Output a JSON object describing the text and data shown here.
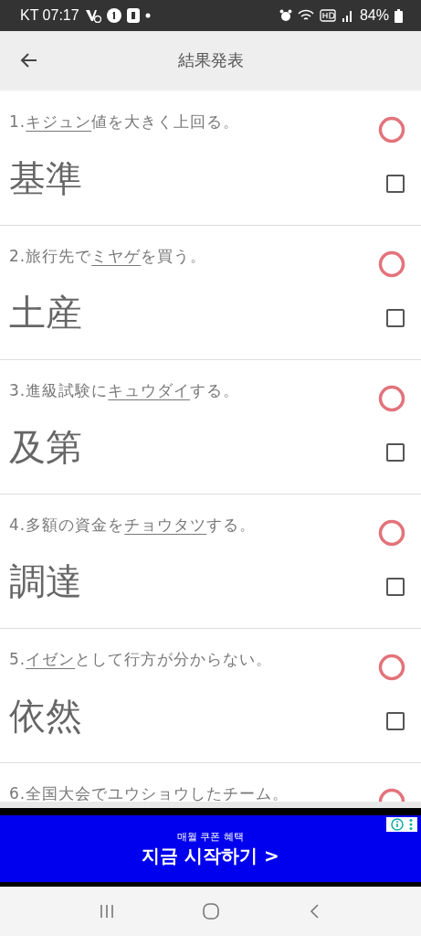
{
  "status_bar": {
    "carrier_time": "KT 07:17",
    "battery": "84%"
  },
  "app_bar": {
    "title": "結果発表"
  },
  "questions": [
    {
      "before": "1.",
      "reading": "キジュン",
      "after": "値を大きく上回る。",
      "correct": true,
      "answer": "基準",
      "checked": false
    },
    {
      "before": "2.旅行先で",
      "reading": "ミヤゲ",
      "after": "を買う。",
      "correct": true,
      "answer": "土産",
      "checked": false
    },
    {
      "before": "3.進級試験に",
      "reading": "キュウダイ",
      "after": "する。",
      "correct": true,
      "answer": "及第",
      "checked": false
    },
    {
      "before": "4.多額の資金を",
      "reading": "チョウタツ",
      "after": "する。",
      "correct": true,
      "answer": "調達",
      "checked": false
    },
    {
      "before": "5.",
      "reading": "イゼン",
      "after": "として行方が分からない。",
      "correct": true,
      "answer": "依然",
      "checked": false
    },
    {
      "before": "6.全国大会で",
      "reading": "ユウショウ",
      "after": "したチーム。",
      "correct": true
    }
  ],
  "ad": {
    "subtitle": "매월 쿠폰 혜택",
    "headline": "지금 시작하기 >"
  }
}
